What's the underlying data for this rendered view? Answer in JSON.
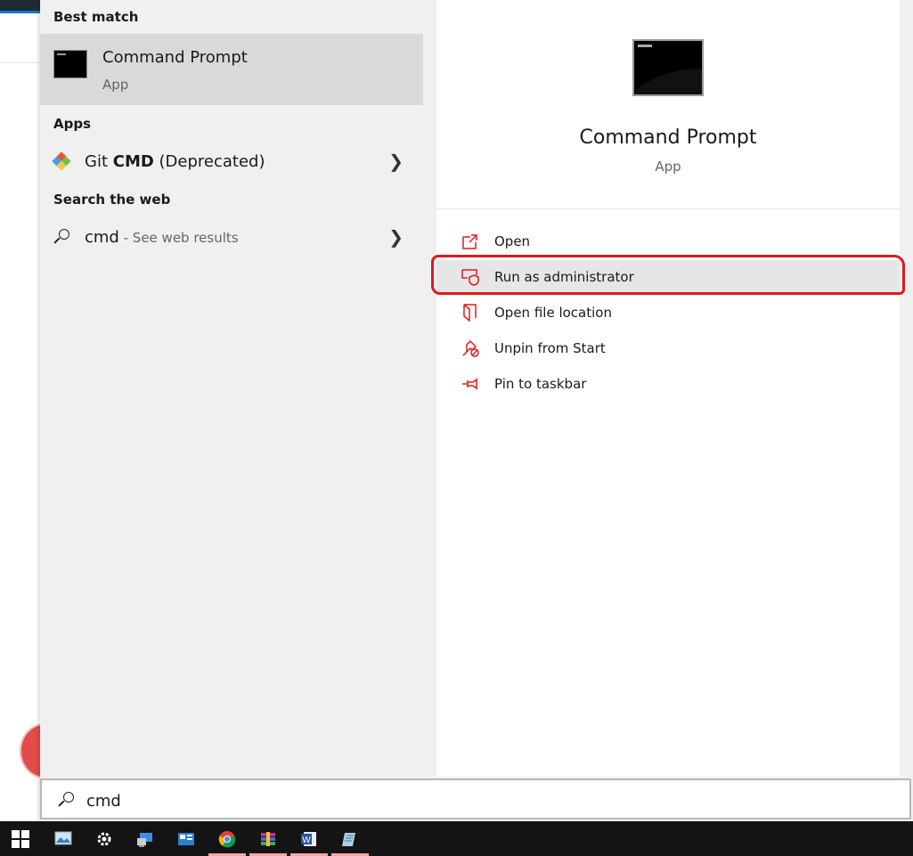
{
  "left": {
    "best_match_header": "Best match",
    "best": {
      "title": "Command Prompt",
      "sub": "App"
    },
    "apps_header": "Apps",
    "apps": [
      {
        "prefix": "Git ",
        "bold": "CMD",
        "suffix": " (Deprecated)"
      }
    ],
    "web_header": "Search the web",
    "web": {
      "query": "cmd",
      "hint": " - See web results"
    }
  },
  "right": {
    "title": "Command Prompt",
    "sub": "App",
    "actions": [
      {
        "label": "Open",
        "icon": "open-icon"
      },
      {
        "label": "Run as administrator",
        "icon": "shield-icon"
      },
      {
        "label": "Open file location",
        "icon": "file-location-icon"
      },
      {
        "label": "Unpin from Start",
        "icon": "unpin-icon"
      },
      {
        "label": "Pin to taskbar",
        "icon": "pin-icon"
      }
    ]
  },
  "search": {
    "value": "cmd"
  },
  "taskbar": {
    "items": [
      "windows-start-icon",
      "photos-icon",
      "settings-icon",
      "remote-desktop-icon",
      "control-panel-icon",
      "chrome-icon",
      "winrar-icon",
      "word-icon",
      "notepad-icon"
    ]
  },
  "colors": {
    "accent": "#e0191c",
    "highlight": "#d9d9d9",
    "panel": "#f0f0f0"
  }
}
